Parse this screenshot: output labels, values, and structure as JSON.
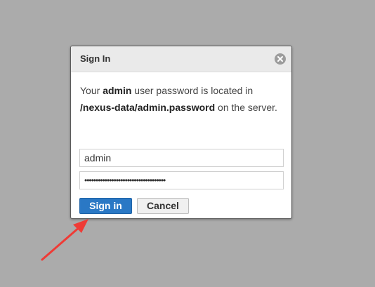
{
  "dialog": {
    "title": "Sign In",
    "close_icon": "close-circle-icon",
    "message": {
      "part1": "Your ",
      "user": "admin",
      "part2": " user password is located in ",
      "path": "/nexus-data/admin.password",
      "part3": " on the server."
    },
    "username_value": "admin",
    "password_value": "••••••••••••••••••••••••••••••••••••",
    "signin_label": "Sign in",
    "cancel_label": "Cancel"
  },
  "annotation": {
    "arrow_icon": "red-arrow-icon",
    "arrow_color": "#ef3b36"
  },
  "colors": {
    "background": "#ababab",
    "primary_button": "#2a78c5"
  }
}
